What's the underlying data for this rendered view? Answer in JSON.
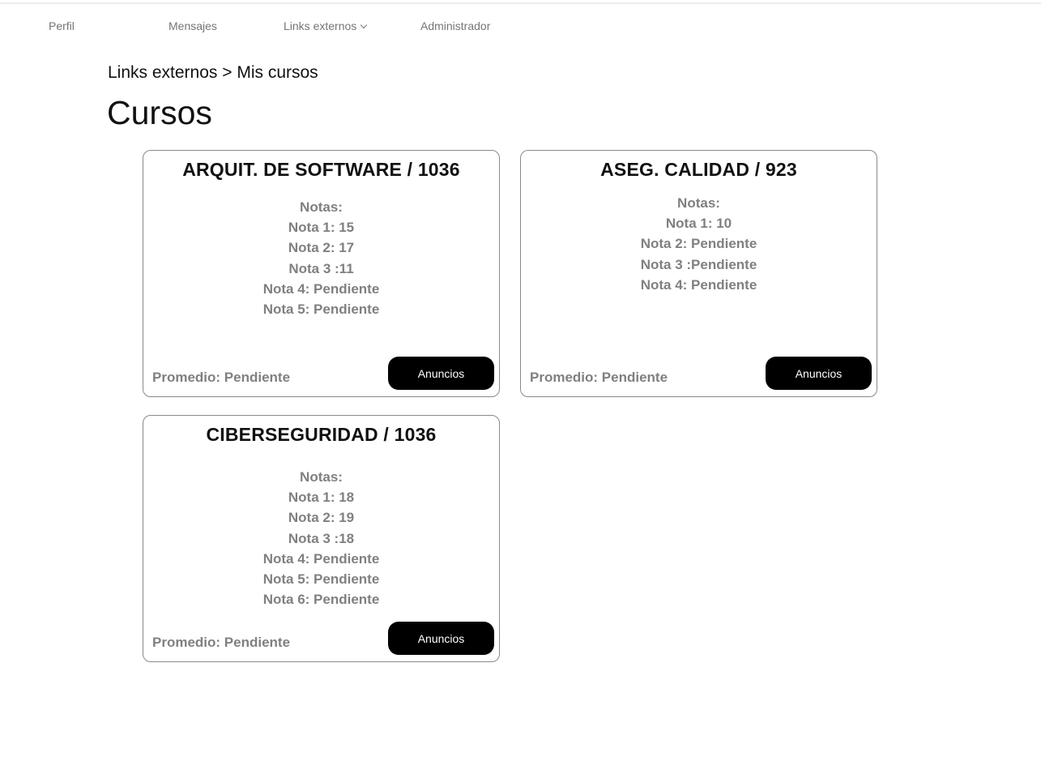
{
  "nav": {
    "items": [
      {
        "label": "Perfil"
      },
      {
        "label": "Mensajes"
      },
      {
        "label": "Links externos",
        "has_dropdown": true,
        "icon": "chevron-down-icon"
      },
      {
        "label": "Administrador"
      }
    ]
  },
  "breadcrumb": "Links externos > Mis cursos",
  "page_title": "Cursos",
  "courses": [
    {
      "title": "ARQUIT. DE SOFTWARE / 1036",
      "notes_heading": "Notas:",
      "notes": [
        "Nota 1: 15",
        "Nota 2: 17",
        "Nota 3 :11",
        "Nota 4: Pendiente",
        "Nota 5: Pendiente"
      ],
      "promedio": "Promedio: Pendiente",
      "button_label": "Anuncios"
    },
    {
      "title": "ASEG. CALIDAD / 923",
      "notes_heading": "Notas:",
      "notes": [
        "Nota 1: 10",
        "Nota 2: Pendiente",
        "Nota 3 :Pendiente",
        "Nota 4: Pendiente"
      ],
      "promedio": "Promedio: Pendiente",
      "button_label": "Anuncios"
    },
    {
      "title": "CIBERSEGURIDAD / 1036",
      "notes_heading": "Notas:",
      "notes": [
        "Nota 1: 18",
        "Nota 2: 19",
        "Nota 3 :18",
        "Nota 4: Pendiente",
        "Nota 5: Pendiente",
        "Nota 6: Pendiente"
      ],
      "promedio": "Promedio: Pendiente",
      "button_label": "Anuncios"
    }
  ]
}
